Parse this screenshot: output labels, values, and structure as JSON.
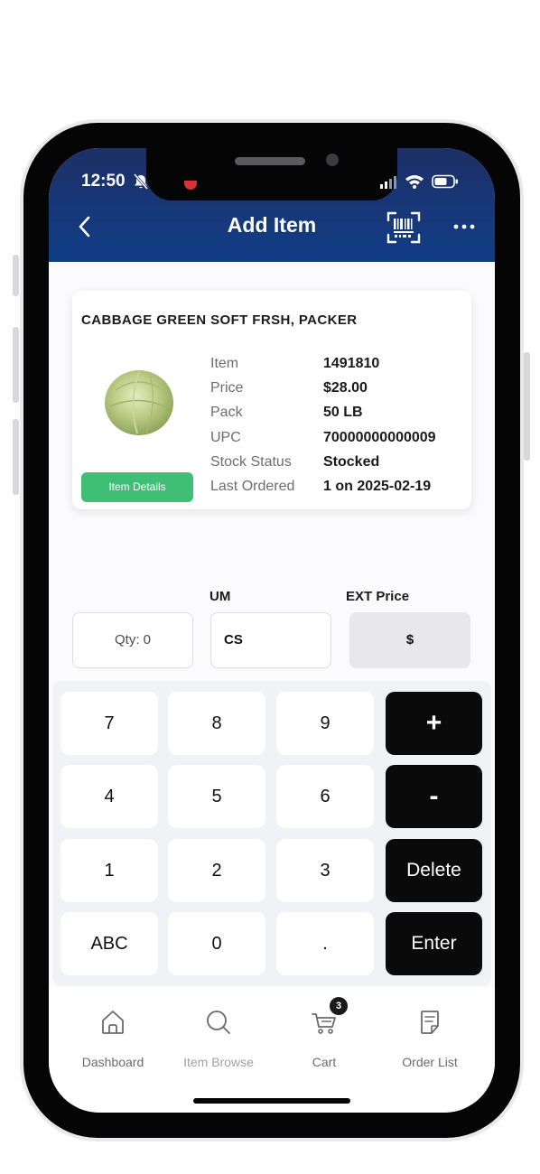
{
  "status_bar": {
    "time": "12:50"
  },
  "header": {
    "title": "Add Item"
  },
  "product": {
    "name": "CABBAGE GREEN SOFT FRSH, PACKER",
    "details_button": "Item Details",
    "details": [
      {
        "label": "Item",
        "value": "1491810"
      },
      {
        "label": "Price",
        "value": "$28.00"
      },
      {
        "label": "Pack",
        "value": "50 LB"
      },
      {
        "label": "UPC",
        "value": "70000000000009"
      },
      {
        "label": "Stock Status",
        "value": "Stocked"
      },
      {
        "label": "Last Ordered",
        "value": "1 on 2025-02-19"
      }
    ]
  },
  "order_fields": {
    "qty_value": "Qty: 0",
    "um_label": "UM",
    "um_value": "CS",
    "ext_label": "EXT Price",
    "ext_value": "$"
  },
  "keypad": {
    "keys": [
      "7",
      "8",
      "9",
      "4",
      "5",
      "6",
      "1",
      "2",
      "3",
      "ABC",
      "0",
      "."
    ],
    "actions": [
      "+",
      "-",
      "Delete",
      "Enter"
    ]
  },
  "bottom_nav": {
    "items": [
      {
        "label": "Dashboard",
        "icon": "home-icon"
      },
      {
        "label": "Item Browse",
        "icon": "search-icon"
      },
      {
        "label": "Cart",
        "icon": "cart-icon",
        "badge": "3"
      },
      {
        "label": "Order List",
        "icon": "order-list-icon"
      }
    ]
  },
  "colors": {
    "header_top": "#1d2f66",
    "header_bottom": "#0f3d86",
    "details_button": "#3fbf75",
    "action_key": "#0a0a0a"
  }
}
